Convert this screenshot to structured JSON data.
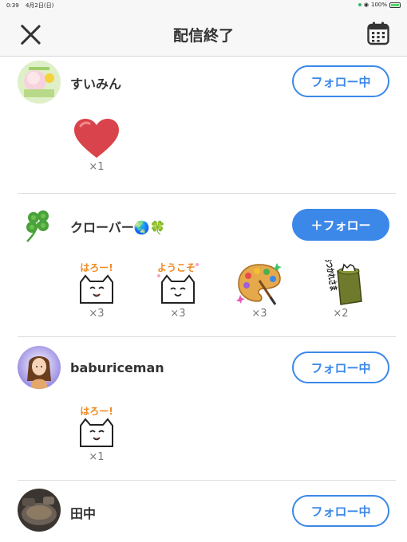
{
  "status_bar": {
    "time": "0:39",
    "date": "4月2日(日)",
    "battery": "100%"
  },
  "nav": {
    "title": "配信終了",
    "close_icon": "close-icon",
    "calendar_icon": "calendar-icon"
  },
  "users": [
    {
      "name": "すいみん",
      "follow_label": "フォロー中",
      "following": true,
      "gifts": [
        {
          "icon": "heart-icon",
          "count": "×1"
        }
      ]
    },
    {
      "name": "クローバー🌏🍀",
      "follow_label": "＋フォロー",
      "following": false,
      "gifts": [
        {
          "icon": "hello-cat-sticker",
          "count": "×3",
          "sticker_text": "はろー!"
        },
        {
          "icon": "welcome-cat-sticker",
          "count": "×3",
          "sticker_text": "ようこそ"
        },
        {
          "icon": "palette-icon",
          "count": "×3"
        },
        {
          "icon": "otsukaresama-sticker",
          "count": "×2",
          "sticker_text": "おつかれさま"
        }
      ]
    },
    {
      "name": "baburiceman",
      "follow_label": "フォロー中",
      "following": true,
      "gifts": [
        {
          "icon": "hello-cat-sticker",
          "count": "×1",
          "sticker_text": "はろー!"
        }
      ]
    },
    {
      "name": "田中",
      "follow_label": "フォロー中",
      "following": true,
      "gifts": []
    }
  ],
  "colors": {
    "accent": "#3b88e8",
    "divider": "#dcdcdc"
  }
}
